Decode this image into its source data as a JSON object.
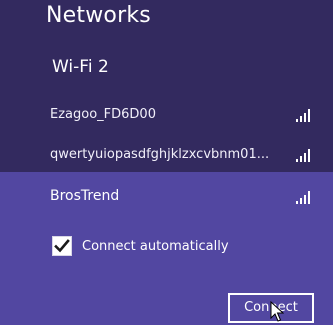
{
  "header": {
    "title": "Networks"
  },
  "group": {
    "label": "Wi-Fi 2"
  },
  "networks": [
    {
      "name": "Ezagoo_FD6D00",
      "icon": "wifi-signal-icon"
    },
    {
      "name": "qwertyuiopasdfghjklzxcvbnm01...",
      "icon": "wifi-signal-icon"
    }
  ],
  "selected_network": {
    "name": "BrosTrend",
    "icon": "wifi-signal-icon",
    "connect_automatically_label": "Connect automatically",
    "connect_automatically_checked": true,
    "connect_button_label": "Connect"
  },
  "colors": {
    "panel_background": "#332a5f",
    "selected_background": "#5247a1",
    "text": "#ffffff"
  }
}
